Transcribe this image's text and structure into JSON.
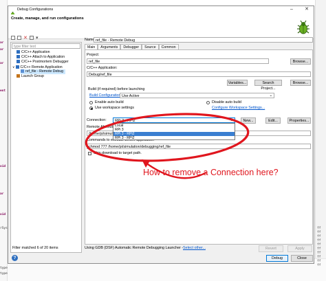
{
  "dialog": {
    "title": "Debug Configurations",
    "header_title": "Create, manage, and run configurations"
  },
  "toolbar_left": {
    "filter_placeholder": "type filter text",
    "filter_status": "Filter matched 6 of 20 items"
  },
  "tree": [
    {
      "label": "C/C++ Application"
    },
    {
      "label": "C/C++ Attach to Application"
    },
    {
      "label": "C/C++ Postmortem Debugger"
    },
    {
      "label": "C/C++ Remote Application"
    },
    {
      "label": "ref_file - Remote Debug"
    },
    {
      "label": "Launch Group"
    }
  ],
  "config": {
    "name_label": "Name:",
    "name_value": "ref_file - Remote Debug",
    "tabs": [
      {
        "label": "Main"
      },
      {
        "label": "Arguments"
      },
      {
        "label": "Debugger"
      },
      {
        "label": "Source"
      },
      {
        "label": "Common"
      }
    ],
    "project_label": "Project:",
    "project_value": "ref_file",
    "app_label": "C/C++ Application:",
    "app_value": "Debug/ref_file",
    "browse": "Browse...",
    "variables": "Variables...",
    "search_project": "Search Project...",
    "build_section": "Build (if required) before launching",
    "build_config_link": "Build Configuration:",
    "build_config_value": "Use Active",
    "enable_auto_build": "Enable auto build",
    "disable_auto_build": "Disable auto build",
    "use_workspace": "Use workspace settings",
    "configure_workspace": "Configure Workspace Settings...",
    "connection_label": "Connection:",
    "connection_value": "RPi 3 - RPi2",
    "connection_options": [
      "Local",
      "RPi 3",
      "RPi 3 - RPi2",
      "RPi 3 - RPi2"
    ],
    "new": "New...",
    "edit": "Edit...",
    "properties": "Properties...",
    "remote_path_label": "Remote Absolute File Path for C/C++ Application:",
    "remote_path_value": "/home/pi/simulation/ref_file",
    "commands_label": "Commands to execute before application",
    "commands_value": "chmod 777 /home/pi/simulation/debugging/ref_file",
    "skip_download": "Skip download to target path.",
    "launcher_prefix": "Using GDB (DSF) Automatic Remote Debugging Launcher -",
    "launcher_link": "Select other...",
    "revert": "Revert",
    "apply": "Apply",
    "debug": "Debug",
    "close": "Close"
  },
  "annotation": {
    "text": "How to remove a Connection here?",
    "color": "#e0161e"
  },
  "editor_left_codes": [
    "ar",
    "ar",
    "ar",
    "ent",
    "oid",
    "ar",
    "oid",
    "rSys",
    "type",
    "type"
  ],
  "editor_right_codes": [
    "ff",
    "ff",
    "ff",
    "ff",
    "ff",
    "ff",
    "ff",
    "ff",
    "ff",
    "ff"
  ],
  "colors": {
    "accent": "#0078d7",
    "link": "#0055cc",
    "selection": "#3a7fd1",
    "bug_icon": "#6ab023"
  }
}
